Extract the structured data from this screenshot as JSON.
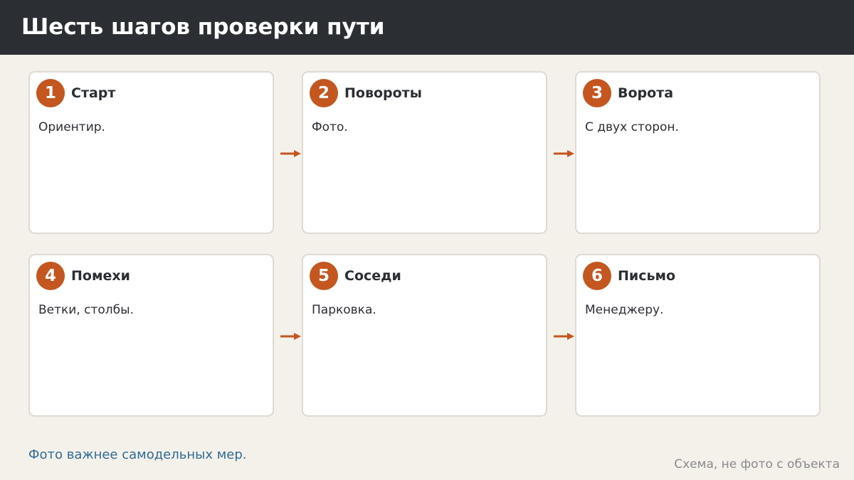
{
  "header": {
    "title": "Шесть шагов проверки пути"
  },
  "colors": {
    "header_bg": "#2b2e33",
    "accent": "#c4561f",
    "page_bg": "#f4f1eb",
    "note": "#2f6b94"
  },
  "steps": [
    {
      "number": "1",
      "title": "Старт",
      "description": "Ориентир."
    },
    {
      "number": "2",
      "title": "Повороты",
      "description": "Фото."
    },
    {
      "number": "3",
      "title": "Ворота",
      "description": "С двух сторон."
    },
    {
      "number": "4",
      "title": "Помехи",
      "description": "Ветки, столбы."
    },
    {
      "number": "5",
      "title": "Соседи",
      "description": "Парковка."
    },
    {
      "number": "6",
      "title": "Письмо",
      "description": "Менеджеру."
    }
  ],
  "footer": {
    "note": "Фото важнее самодельных мер.",
    "caption": "Схема, не фото с объекта"
  }
}
